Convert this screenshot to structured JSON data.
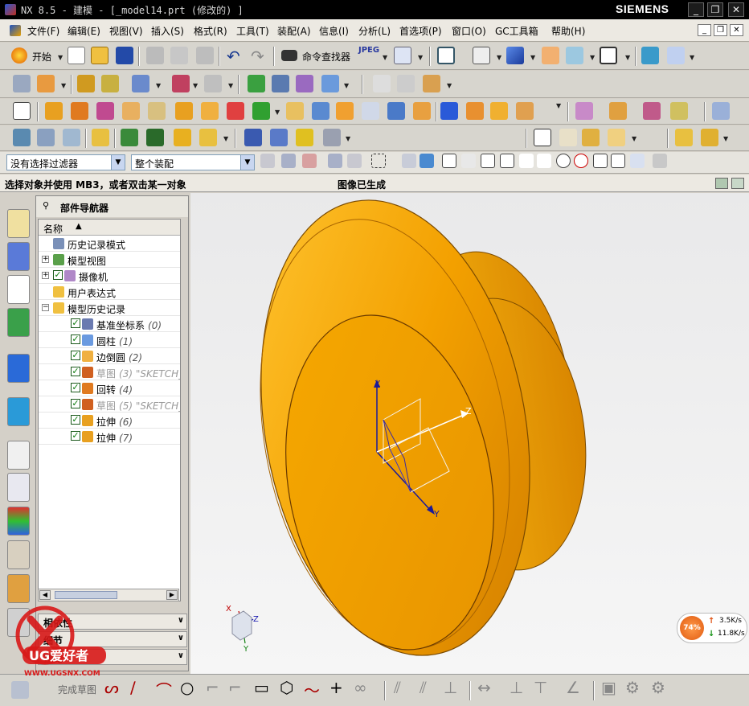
{
  "window": {
    "title": "NX 8.5 - 建模 - [_model14.prt  (修改的) ]",
    "brand": "SIEMENS",
    "minimize_label": "_",
    "restore_label": "❐",
    "close_label": "✕"
  },
  "menu": {
    "items": [
      "文件(F)",
      "编辑(E)",
      "视图(V)",
      "插入(S)",
      "格式(R)",
      "工具(T)",
      "装配(A)",
      "信息(I)",
      "分析(L)",
      "首选项(P)",
      "窗口(O)",
      "GC工具箱",
      "帮助(H)"
    ]
  },
  "toolbar": {
    "start_label": "开始",
    "command_finder_label": "命令查找器",
    "jpeg_label": "JPEG",
    "filter_value": "没有选择过滤器",
    "scope_value": "整个装配"
  },
  "status": {
    "prompt": "选择对象并使用 MB3，或者双击某一对象",
    "message": "图像已生成"
  },
  "navigator": {
    "title": "部件导航器",
    "column_name": "名称",
    "column_sort_icon": "▲",
    "items": [
      {
        "label": "历史记录模式",
        "icon": "clock-icon",
        "level": 0,
        "expander": "",
        "checked": false,
        "dim": false
      },
      {
        "label": "模型视图",
        "icon": "model-views-icon",
        "level": 0,
        "expander": "+",
        "checked": false,
        "dim": false
      },
      {
        "label": "摄像机",
        "icon": "camera-icon",
        "level": 0,
        "expander": "+",
        "checked": true,
        "dim": false
      },
      {
        "label": "用户表达式",
        "icon": "folder-icon",
        "level": 0,
        "expander": "",
        "checked": false,
        "dim": false
      },
      {
        "label": "模型历史记录",
        "icon": "folder-open-icon",
        "level": 0,
        "expander": "−",
        "checked": false,
        "dim": false
      },
      {
        "label": "基准坐标系",
        "suffix": "(0)",
        "icon": "datum-csys-icon",
        "level": 1,
        "checked": true,
        "dim": false
      },
      {
        "label": "圆柱",
        "suffix": "(1)",
        "icon": "cylinder-icon",
        "level": 1,
        "checked": true,
        "dim": false
      },
      {
        "label": "边倒圆",
        "suffix": "(2)",
        "icon": "edge-blend-icon",
        "level": 1,
        "checked": true,
        "dim": false
      },
      {
        "label": "草图",
        "suffix": "(3) \"SKETCH_",
        "icon": "sketch-icon",
        "level": 1,
        "checked": true,
        "dim": true
      },
      {
        "label": "回转",
        "suffix": "(4)",
        "icon": "revolve-icon",
        "level": 1,
        "checked": true,
        "dim": false
      },
      {
        "label": "草图",
        "suffix": "(5) \"SKETCH_",
        "icon": "sketch-icon",
        "level": 1,
        "checked": true,
        "dim": true
      },
      {
        "label": "拉伸",
        "suffix": "(6)",
        "icon": "extrude-icon",
        "level": 1,
        "checked": true,
        "dim": false
      },
      {
        "label": "拉伸",
        "suffix": "(7)",
        "icon": "extrude-icon",
        "level": 1,
        "checked": true,
        "dim": false
      }
    ],
    "panels": [
      "相依性",
      "细节",
      "预览"
    ]
  },
  "viewport": {
    "axis_x": "X",
    "axis_y": "Y",
    "axis_z": "Z",
    "triad_x": "X",
    "triad_y": "Y",
    "triad_z": "Z",
    "model_color": "#f5a300"
  },
  "network": {
    "percent": "74%",
    "up": "3.5K/s",
    "down": "11.8K/s",
    "up_arrow": "↑",
    "down_arrow": "↓"
  },
  "bottom": {
    "finish_sketch_label": "完成草图"
  },
  "watermark": {
    "brand": "UG爱好者",
    "url": "WWW.UGSNX.COM"
  }
}
